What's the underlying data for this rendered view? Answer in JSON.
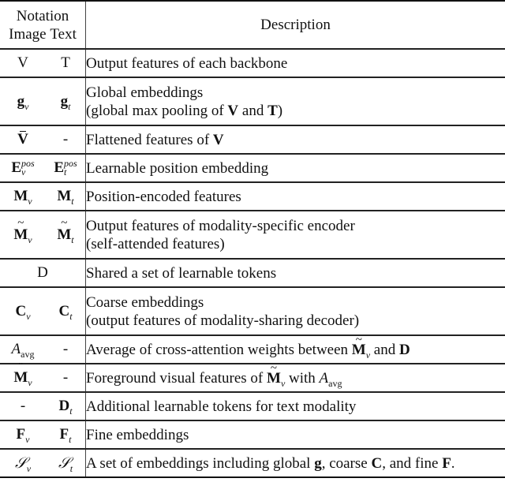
{
  "header": {
    "notation": "Notation",
    "image": "Image",
    "text": "Text",
    "description": "Description"
  },
  "rows": [
    {
      "image": "V",
      "text": "T",
      "desc": [
        "Output features of each backbone"
      ]
    },
    {
      "image": "g_v",
      "text": "g_t",
      "desc": [
        "Global embeddings",
        "(global max pooling of V and T)"
      ]
    },
    {
      "image": "V̄",
      "text": "-",
      "desc": [
        "Flattened features of V"
      ]
    },
    {
      "image": "E_v^pos",
      "text": "E_t^pos",
      "desc": [
        "Learnable position embedding"
      ]
    },
    {
      "image": "M_v",
      "text": "M_t",
      "desc": [
        "Position-encoded features"
      ]
    },
    {
      "image": "M̃_v",
      "text": "M̃_t",
      "desc": [
        "Output features of modality-specific encoder",
        "(self-attended features)"
      ]
    },
    {
      "image": "D",
      "text": "",
      "desc": [
        "Shared a set of learnable tokens"
      ]
    },
    {
      "image": "C_v",
      "text": "C_t",
      "desc": [
        "Coarse embeddings",
        "(output features of modality-sharing decoder)"
      ]
    },
    {
      "image": "A_avg",
      "text": "-",
      "desc": [
        "Average of cross-attention weights between M̃_v and D"
      ]
    },
    {
      "image": "M̈_v",
      "text": "-",
      "desc": [
        "Foreground visual features of M̃_v with A_avg"
      ]
    },
    {
      "image": "-",
      "text": "D_t",
      "desc": [
        "Additional learnable tokens for text modality"
      ]
    },
    {
      "image": "F_v",
      "text": "F_t",
      "desc": [
        "Fine embeddings"
      ]
    },
    {
      "image": "S_v",
      "text": "S_t",
      "desc": [
        "A set of embeddings including global g, coarse C, and fine F."
      ]
    }
  ],
  "text": {
    "r1": "Output features of each backbone",
    "r2a": "Global embeddings",
    "r2b_pre": "(global max pooling of ",
    "r2b_and": " and ",
    "r2b_post": ")",
    "r3": "Flattened features of ",
    "r4": "Learnable position embedding",
    "r5": "Position-encoded features",
    "r6a": "Output features of modality-specific encoder",
    "r6b": "(self-attended features)",
    "r7": "Shared a set of learnable tokens",
    "r8a": "Coarse embeddings",
    "r8b": "(output features of modality-sharing decoder)",
    "r9_pre": "Average of cross-attention weights between ",
    "r9_and": " and ",
    "r10_pre": "Foreground visual features of ",
    "r10_with": " with ",
    "r11": "Additional learnable tokens for text modality",
    "r12": "Fine embeddings",
    "r13_pre": "A set of embeddings including global ",
    "r13_c": ", coarse ",
    "r13_f": ", and fine ",
    "r13_end": ".",
    "dash": "-",
    "sym": {
      "V": "V",
      "T": "T",
      "g": "g",
      "E": "E",
      "M": "M",
      "D": "D",
      "C": "C",
      "A": "A",
      "F": "F",
      "S": "𝒮",
      "v": "v",
      "t": "t",
      "pos": "pos",
      "avg": "avg"
    }
  }
}
